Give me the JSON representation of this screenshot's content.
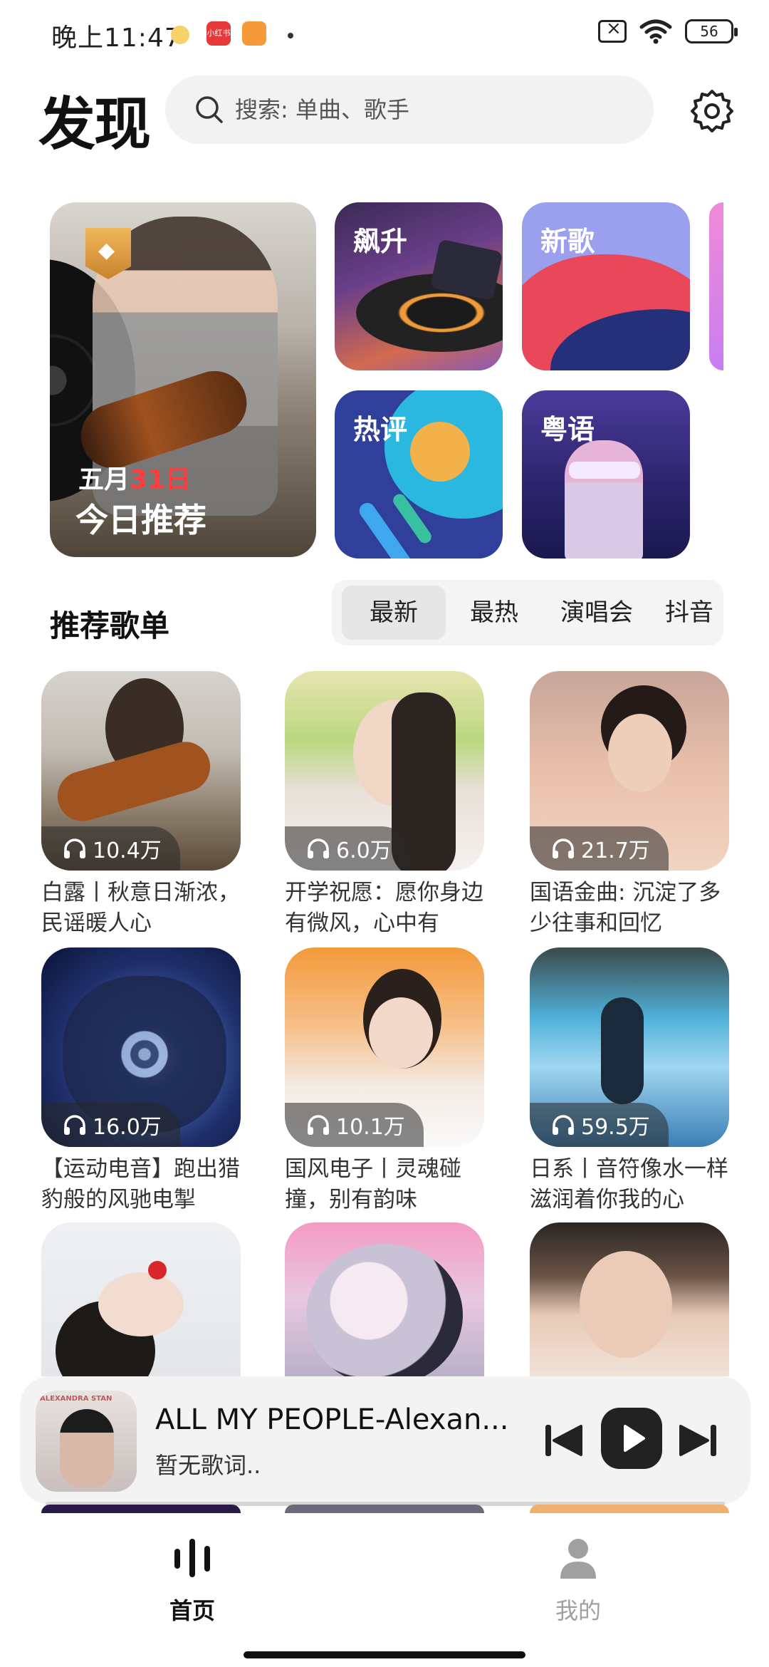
{
  "status_bar": {
    "time": "晚上11:47",
    "app_badge": "小红书",
    "battery": "56"
  },
  "header": {
    "title": "发现",
    "search_placeholder": "搜索: 单曲、歌手"
  },
  "featured": {
    "main": {
      "month": "五月",
      "day": "31日",
      "title": "今日推荐"
    },
    "tiles": [
      "飙升",
      "新歌",
      "热评",
      "粤语"
    ]
  },
  "section": {
    "title": "推荐歌单",
    "tabs": [
      "最新",
      "最热",
      "演唱会",
      "抖音"
    ],
    "active_tab": "最新"
  },
  "playlists": [
    {
      "plays": "10.4万",
      "title": "白露丨秋意日渐浓，民谣暖人心"
    },
    {
      "plays": "6.0万",
      "title": "开学祝愿：愿你身边有微风，心中有"
    },
    {
      "plays": "21.7万",
      "title": "国语金曲: 沉淀了多少往事和回忆"
    },
    {
      "plays": "16.0万",
      "title": "【运动电音】跑出猎豹般的风驰电掣"
    },
    {
      "plays": "10.1万",
      "title": "国风电子丨灵魂碰撞，别有韵味"
    },
    {
      "plays": "59.5万",
      "title": "日系丨音符像水一样滋润着你我的心"
    }
  ],
  "player": {
    "song": "ALL MY PEOPLE-Alexan...",
    "lyric": "暂无歌词..",
    "art_text": "ALEXANDRA STAN",
    "progress": 0.0
  },
  "bottom_nav": {
    "items": [
      {
        "label": "首页",
        "icon": "equalizer-icon",
        "active": true
      },
      {
        "label": "我的",
        "icon": "person-icon",
        "active": false
      }
    ],
    "active_color": "#111111",
    "inactive_color": "#a0a0a0"
  },
  "colors": {
    "accent_date": "#ff3b3b",
    "search_bg": "#f2f2f2",
    "player_bg": "#f3f3f3"
  }
}
